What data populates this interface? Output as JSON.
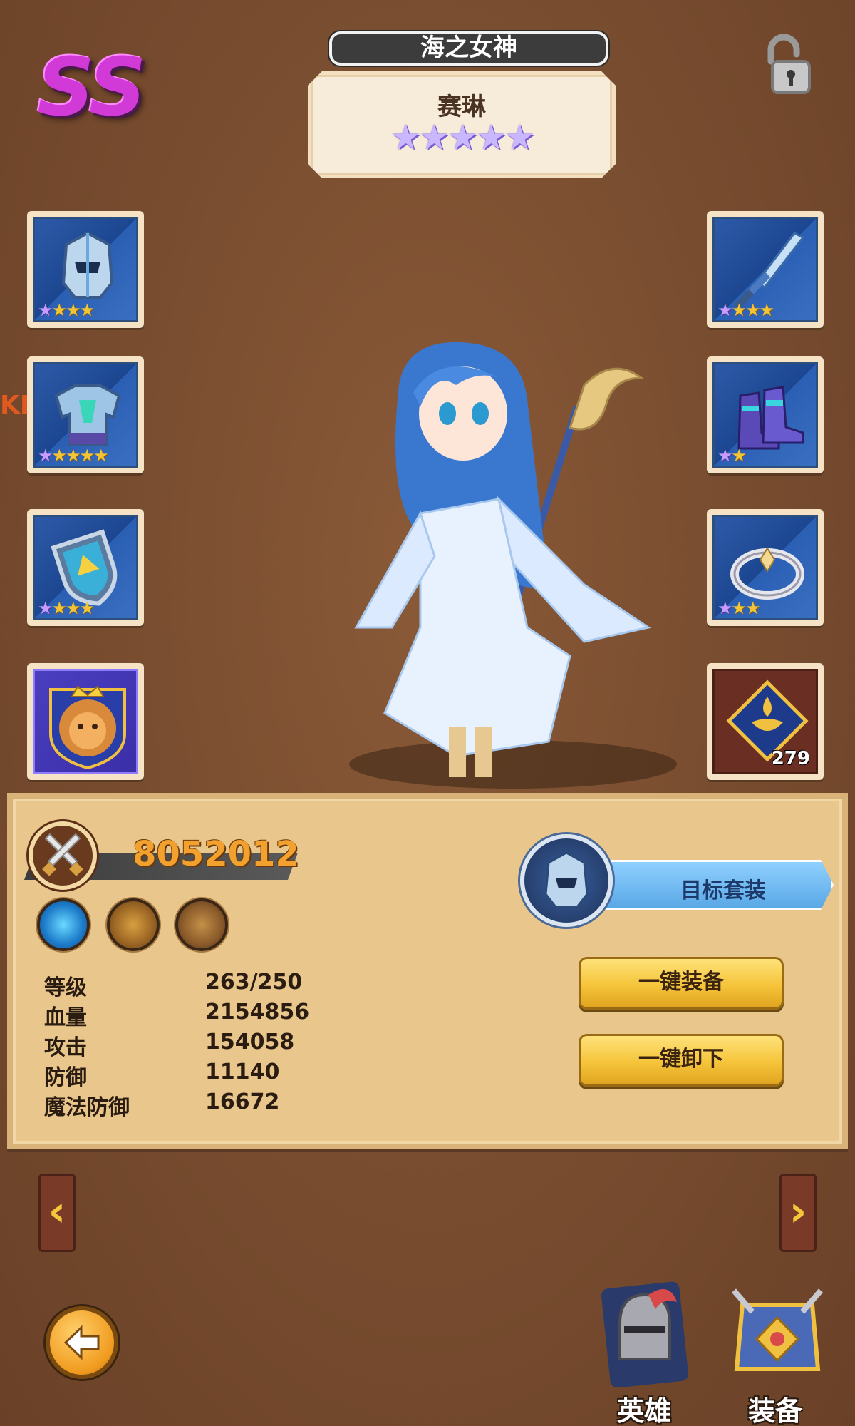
{
  "header": {
    "rank": "SS",
    "title": "海之女神",
    "hero_name": "赛琳",
    "hero_stars": 5
  },
  "left_slots": [
    {
      "name": "helmet",
      "stars": [
        1,
        3
      ],
      "icon": "helmet-icon"
    },
    {
      "name": "armor",
      "stars": [
        1,
        4
      ],
      "icon": "armor-icon"
    },
    {
      "name": "shield",
      "stars": [
        1,
        3
      ],
      "icon": "shield-icon"
    },
    {
      "name": "emblem",
      "stars": [],
      "icon": "lion-emblem-icon"
    }
  ],
  "right_slots": [
    {
      "name": "sword",
      "stars": [
        1,
        3
      ],
      "icon": "sword-icon"
    },
    {
      "name": "boots",
      "stars": [
        1,
        1
      ],
      "icon": "boots-icon"
    },
    {
      "name": "ring",
      "stars": [
        1,
        2
      ],
      "icon": "ring-icon"
    },
    {
      "name": "rune",
      "stars": [],
      "icon": "rune-icon",
      "count": "279"
    }
  ],
  "side_mark": "KD",
  "power": {
    "value": "8052012"
  },
  "skills": [
    "water-skill-icon",
    "staff-skill-icon",
    "wand-skill-icon"
  ],
  "stats": [
    {
      "label": "等级",
      "value": "263/250"
    },
    {
      "label": "血量",
      "value": "2154856"
    },
    {
      "label": "攻击",
      "value": "154058"
    },
    {
      "label": "防御",
      "value": "11140"
    },
    {
      "label": "魔法防御",
      "value": "16672"
    }
  ],
  "target_set": {
    "label": "目标套装"
  },
  "buttons": {
    "equip_all": "一键装备",
    "unequip_all": "一键卸下"
  },
  "tabs": {
    "hero": "英雄",
    "equipment": "装备"
  },
  "colors": {
    "rank": "#d23ad8",
    "power": "#f2a12e",
    "button": "#f5c43a",
    "target": "#5aa8e6"
  }
}
